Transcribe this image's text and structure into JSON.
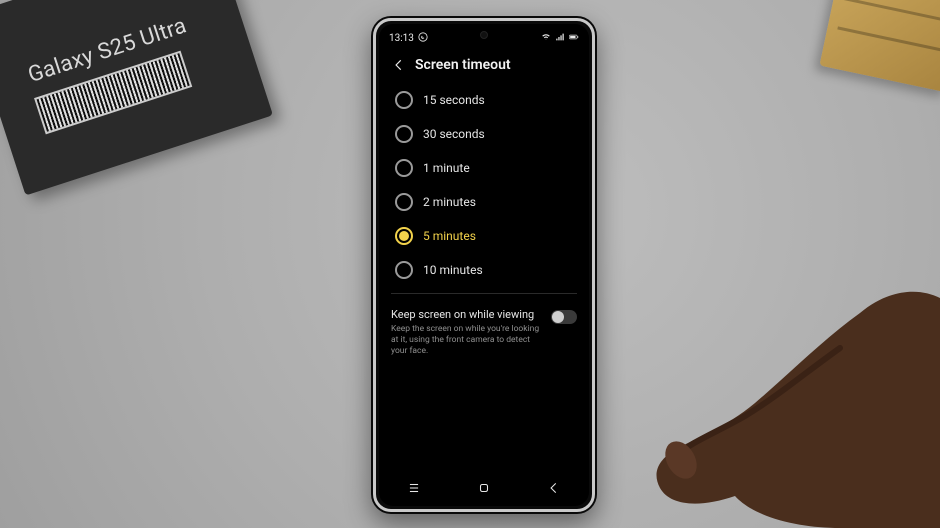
{
  "physical": {
    "box_label": "Galaxy S25 Ultra"
  },
  "statusbar": {
    "time": "13:13"
  },
  "header": {
    "title": "Screen timeout"
  },
  "timeout_options": [
    {
      "label": "15 seconds",
      "selected": false
    },
    {
      "label": "30 seconds",
      "selected": false
    },
    {
      "label": "1 minute",
      "selected": false
    },
    {
      "label": "2 minutes",
      "selected": false
    },
    {
      "label": "5 minutes",
      "selected": true
    },
    {
      "label": "10 minutes",
      "selected": false
    }
  ],
  "keep_screen": {
    "title": "Keep screen on while viewing",
    "desc": "Keep the screen on while you're looking at it, using the front camera to detect your face.",
    "enabled": false
  }
}
